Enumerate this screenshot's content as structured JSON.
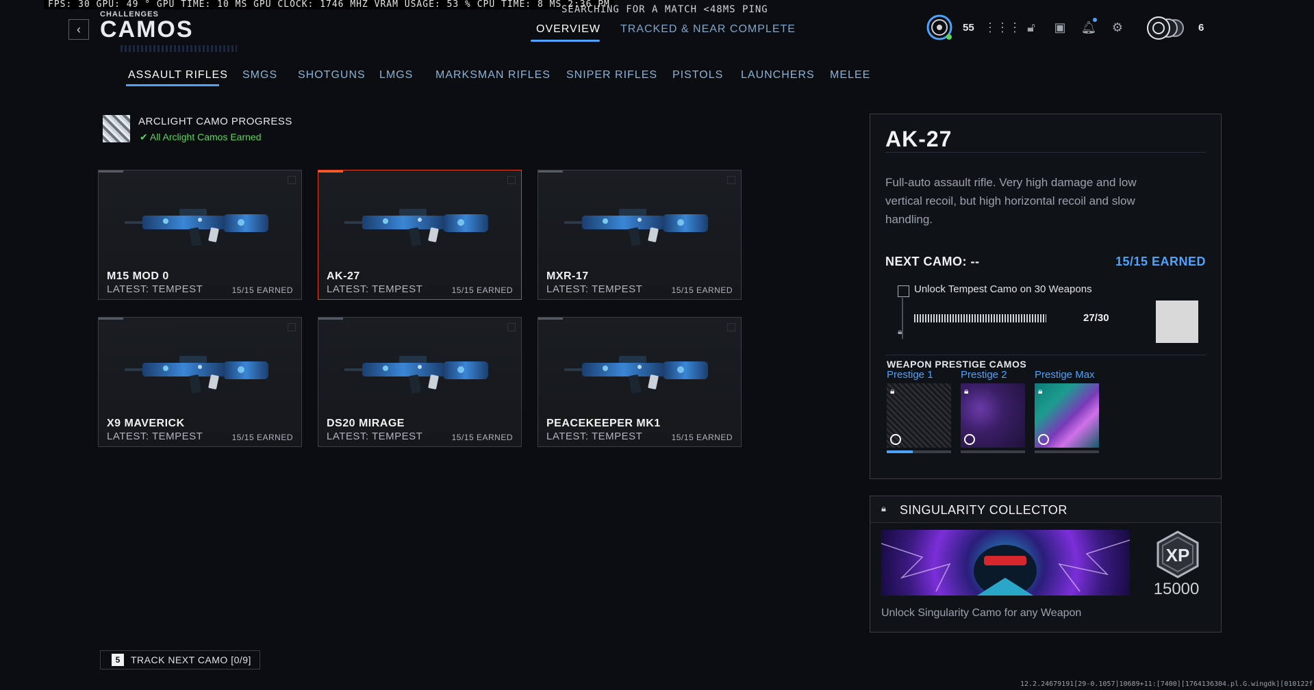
{
  "overlay": {
    "stats": "FPS:  30  GPU: 49 °  GPU TIME: 10 MS  GPU CLOCK: 1746 MHZ  VRAM USAGE: 53 %  CPU TIME:  8 MS  2:36 PM",
    "search": "SEARCHING FOR A MATCH  <48MS PING"
  },
  "header": {
    "subtitle": "CHALLENGES",
    "title": "CAMOS",
    "tabs": [
      {
        "label": "OVERVIEW",
        "active": true
      },
      {
        "label": "TRACKED & NEAR COMPLETE",
        "active": false
      }
    ],
    "level": "55",
    "prestige_count": "6"
  },
  "categories": [
    {
      "label": "ASSAULT RIFLES",
      "active": true
    },
    {
      "label": "SMGS"
    },
    {
      "label": "SHOTGUNS"
    },
    {
      "label": "LMGS"
    },
    {
      "label": "MARKSMAN RIFLES"
    },
    {
      "label": "SNIPER RIFLES"
    },
    {
      "label": "PISTOLS"
    },
    {
      "label": "LAUNCHERS"
    },
    {
      "label": "MELEE"
    }
  ],
  "arclight": {
    "title": "ARCLIGHT CAMO PROGRESS",
    "status": "All Arclight Camos Earned"
  },
  "weapons": [
    {
      "name": "M15 MOD 0",
      "latest": "LATEST: TEMPEST",
      "earned": "15/15 EARNED"
    },
    {
      "name": "AK-27",
      "latest": "LATEST: TEMPEST",
      "earned": "15/15 EARNED",
      "selected": true
    },
    {
      "name": "MXR-17",
      "latest": "LATEST: TEMPEST",
      "earned": "15/15 EARNED"
    },
    {
      "name": "X9 MAVERICK",
      "latest": "LATEST: TEMPEST",
      "earned": "15/15 EARNED"
    },
    {
      "name": "DS20 MIRAGE",
      "latest": "LATEST: TEMPEST",
      "earned": "15/15 EARNED"
    },
    {
      "name": "PEACEKEEPER MK1",
      "latest": "LATEST: TEMPEST",
      "earned": "15/15 EARNED"
    }
  ],
  "detail": {
    "name": "AK-27",
    "description": "Full-auto assault rifle. Very high damage and low vertical recoil, but high horizontal recoil and slow handling.",
    "next_camo": "NEXT CAMO: --",
    "earned_count": "15/15 EARNED",
    "challenge": "Unlock Tempest Camo on 30 Weapons",
    "progress_text": "27/30",
    "progress_fraction": 0.9,
    "prestige_title": "WEAPON PRESTIGE CAMOS",
    "prestige": [
      {
        "label": "Prestige 1",
        "progress": 0.4
      },
      {
        "label": "Prestige 2",
        "progress": 0
      },
      {
        "label": "Prestige Max",
        "progress": 0
      }
    ]
  },
  "singularity": {
    "title": "SINGULARITY COLLECTOR",
    "xp": "15000",
    "xp_badge": "XP",
    "description": "Unlock Singularity Camo for any Weapon"
  },
  "track": {
    "key": "5",
    "label": "TRACK NEXT CAMO [0/9]"
  },
  "build_info": "12.2.24679191[29-0.1057]10689+11:[7400][1764136304.pl.G.wingdk][010122f",
  "colors": {
    "accent": "#4da3ff",
    "selected_border": "#e0421f",
    "success": "#5bd65b"
  }
}
